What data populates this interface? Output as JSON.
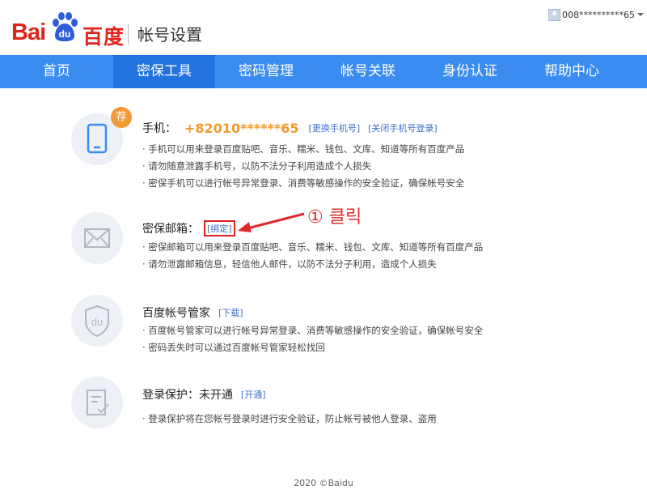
{
  "header": {
    "logo_bai": "Bai",
    "logo_du": "du",
    "logo_cn": "百度",
    "title": "帐号设置",
    "username": "008**********65"
  },
  "nav": {
    "items": [
      "首页",
      "密保工具",
      "密码管理",
      "帐号关联",
      "身份认证",
      "帮助中心"
    ],
    "active_index": 1
  },
  "phone_section": {
    "badge": "荐",
    "label": "手机：",
    "number": "+82010******65",
    "link_change": "[更换手机号]",
    "link_close": "[关闭手机号登录]",
    "desc": [
      "· 手机可以用来登录百度贴吧、音乐、糯米、钱包、文库、知道等所有百度产品",
      "· 请勿随意泄露手机号，以防不法分子利用造成个人损失",
      "· 密保手机可以进行帐号异常登录、消费等敏感操作的安全验证，确保帐号安全"
    ]
  },
  "email_section": {
    "label": "密保邮箱：",
    "link_bind": "[绑定]",
    "desc": [
      "· 密保邮箱可以用来登录百度贴吧、音乐、糯米、钱包、文库、知道等所有百度产品",
      "· 请勿泄露邮箱信息，轻信他人邮件，以防不法分子利用，造成个人损失"
    ]
  },
  "manager_section": {
    "label": "百度帐号管家",
    "link_download": "[下载]",
    "icon_text": "du",
    "desc": [
      "· 百度帐号管家可以进行帐号异常登录、消费等敏感操作的安全验证，确保帐号安全",
      "· 密码丢失时可以通过百度帐号管家轻松找回"
    ]
  },
  "login_protect_section": {
    "label": "登录保护：未开通",
    "link_enable": "[开通]",
    "desc": [
      "· 登录保护将在您帐号登录时进行安全验证，防止帐号被他人登录、盗用"
    ]
  },
  "annotation": {
    "text": "① 클릭"
  },
  "footer": {
    "text": "2020 ©Baidu"
  },
  "colors": {
    "brand_red": "#e1251b",
    "brand_blue": "#2e5ed6",
    "nav_bg": "#3b8cf0",
    "nav_active": "#2273dd",
    "phone_orange": "#f39a2b",
    "link_blue": "#3b6fc9",
    "annotation_red": "#e02a2a"
  }
}
